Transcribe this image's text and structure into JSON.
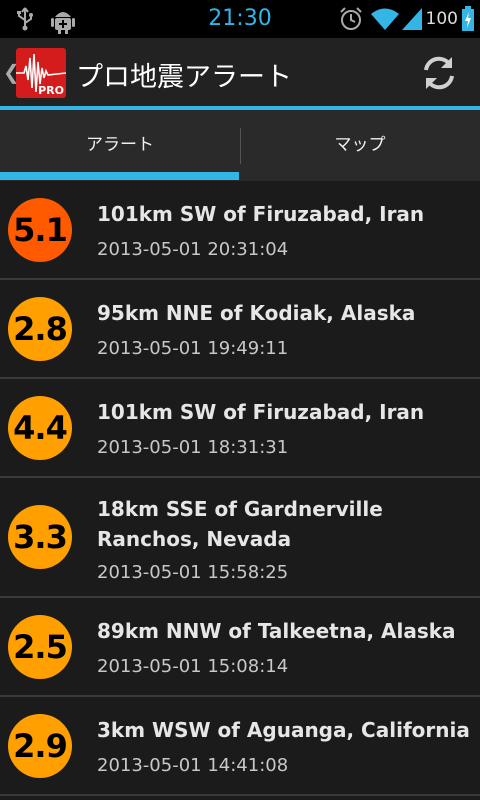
{
  "status_bar": {
    "time": "21:30",
    "battery": "100",
    "icons": [
      "usb-icon",
      "android-debug-icon",
      "alarm-icon",
      "wifi-icon",
      "signal-icon",
      "battery-charging-icon"
    ]
  },
  "action_bar": {
    "title": "プロ地震アラート",
    "app_icon_badge": "PRO",
    "refresh_icon": "refresh-icon",
    "up_icon": "chevron-left-icon"
  },
  "tabs": [
    {
      "label": "アラート",
      "selected": true
    },
    {
      "label": "マップ",
      "selected": false
    }
  ],
  "quakes": [
    {
      "magnitude": "5.1",
      "place": "101km SW of Firuzabad, Iran",
      "datetime": "2013-05-01 20:31:04",
      "color": "#ff5a00"
    },
    {
      "magnitude": "2.8",
      "place": "95km NNE of Kodiak, Alaska",
      "datetime": "2013-05-01 19:49:11",
      "color": "#ffa000"
    },
    {
      "magnitude": "4.4",
      "place": "101km SW of Firuzabad, Iran",
      "datetime": "2013-05-01 18:31:31",
      "color": "#ffa000"
    },
    {
      "magnitude": "3.3",
      "place": "18km SSE of Gardnerville Ranchos, Nevada",
      "datetime": "2013-05-01 15:58:25",
      "color": "#ffa000"
    },
    {
      "magnitude": "2.5",
      "place": "89km NNW of Talkeetna, Alaska",
      "datetime": "2013-05-01 15:08:14",
      "color": "#ffa000"
    },
    {
      "magnitude": "2.9",
      "place": "3km WSW of Aguanga, California",
      "datetime": "2013-05-01 14:41:08",
      "color": "#ffa000"
    }
  ],
  "colors": {
    "accent": "#33b5e5",
    "major": "#ff5a00",
    "minor": "#ffa000",
    "brand": "#d51c1c"
  }
}
